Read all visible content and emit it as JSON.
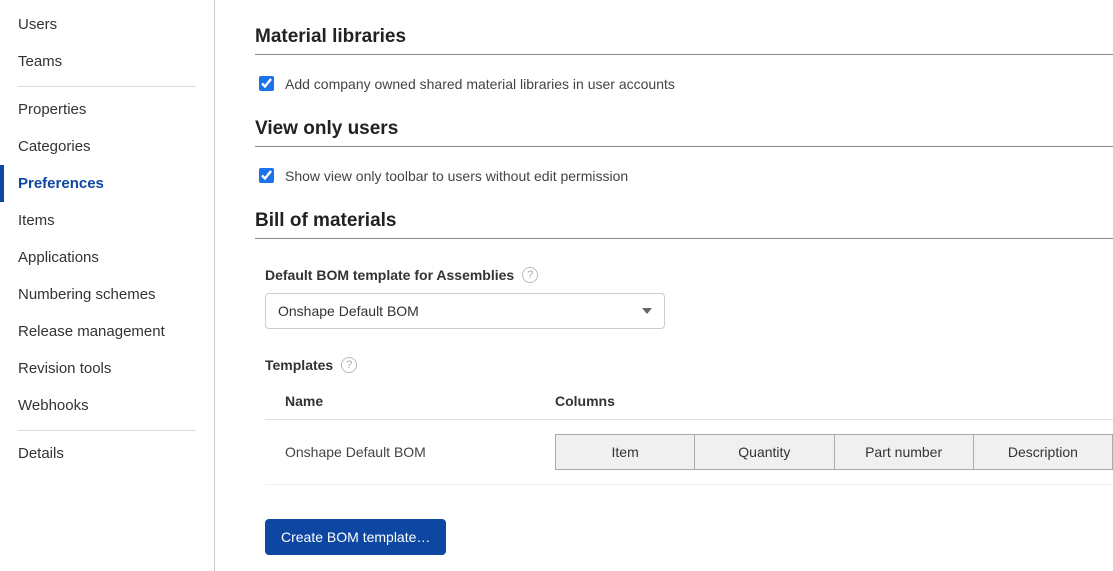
{
  "sidebar": {
    "group1": [
      {
        "label": "Users"
      },
      {
        "label": "Teams"
      }
    ],
    "group2": [
      {
        "label": "Properties"
      },
      {
        "label": "Categories"
      },
      {
        "label": "Preferences",
        "active": true
      },
      {
        "label": "Items"
      },
      {
        "label": "Applications"
      },
      {
        "label": "Numbering schemes"
      },
      {
        "label": "Release management"
      },
      {
        "label": "Revision tools"
      },
      {
        "label": "Webhooks"
      }
    ],
    "group3": [
      {
        "label": "Details"
      }
    ]
  },
  "sections": {
    "material": {
      "heading": "Material libraries",
      "checkbox_label": "Add company owned shared material libraries in user accounts",
      "checked": true
    },
    "viewonly": {
      "heading": "View only users",
      "checkbox_label": "Show view only toolbar to users without edit permission",
      "checked": true
    },
    "bom": {
      "heading": "Bill of materials",
      "default_template_label": "Default BOM template for Assemblies",
      "default_template_value": "Onshape Default BOM",
      "templates_label": "Templates",
      "table": {
        "headers": {
          "name": "Name",
          "columns": "Columns"
        },
        "rows": [
          {
            "name": "Onshape Default BOM",
            "columns": [
              "Item",
              "Quantity",
              "Part number",
              "Description"
            ]
          }
        ]
      },
      "create_button": "Create BOM template…"
    }
  },
  "help_glyph": "?"
}
